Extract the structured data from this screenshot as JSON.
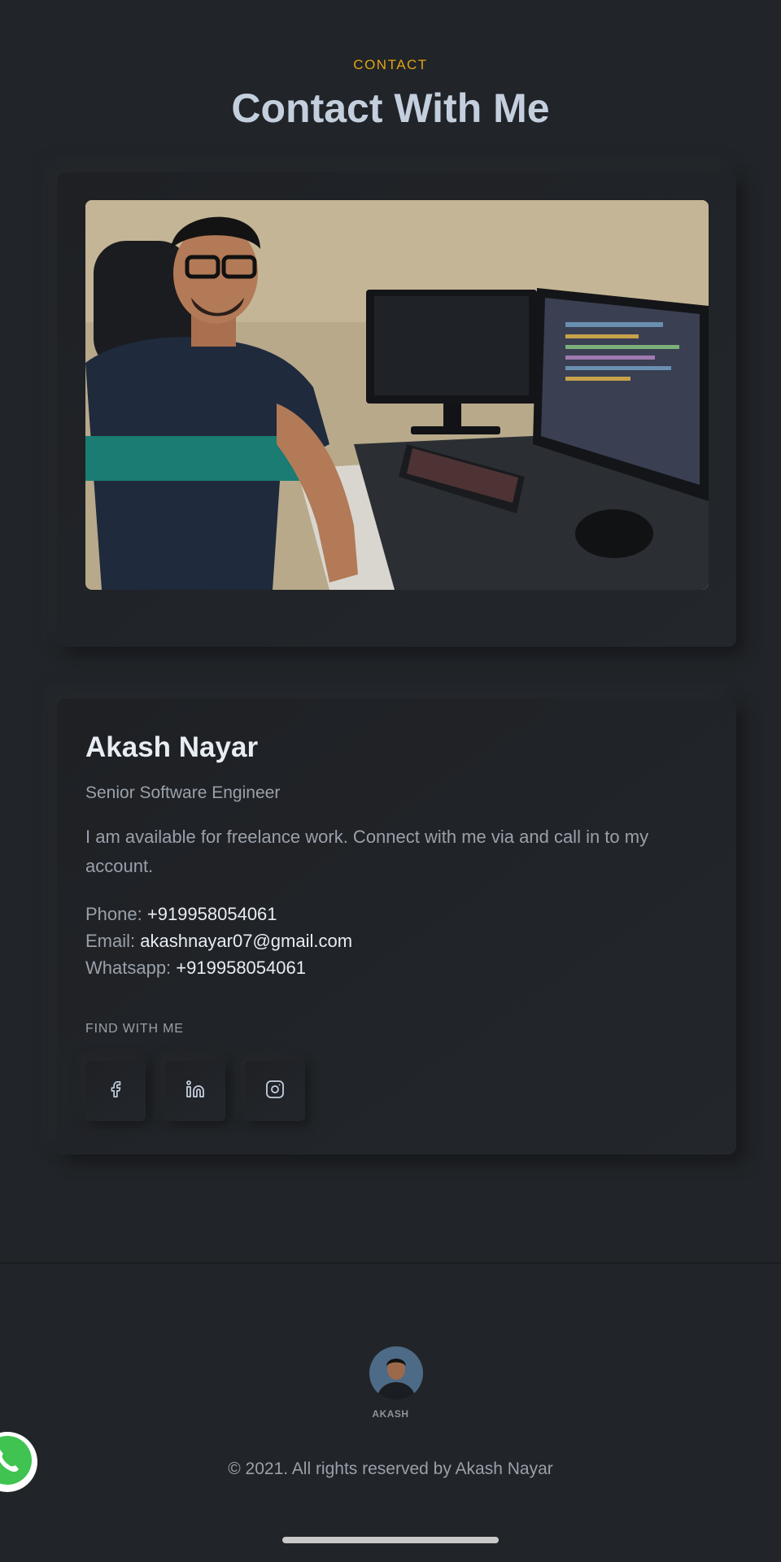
{
  "section": {
    "eyebrow": "CONTACT",
    "title": "Contact With Me"
  },
  "profile": {
    "name": "Akash Nayar",
    "role": "Senior Software Engineer",
    "description": "I am available for freelance work. Connect with me via and call in to my account.",
    "phone_label": "Phone:",
    "phone": "+919958054061",
    "email_label": "Email:",
    "email": "akashnayar07@gmail.com",
    "whatsapp_label": "Whatsapp:",
    "whatsapp": "+919958054061",
    "find_label": "FIND WITH ME",
    "socials": [
      "facebook-icon",
      "linkedin-icon",
      "instagram-icon"
    ]
  },
  "footer": {
    "avatar_name": "AKASH",
    "copyright": "© 2021. All rights reserved by Akash Nayar"
  },
  "colors": {
    "background": "#212428",
    "accent": "#e0a418",
    "heading": "#c4cfde",
    "text": "#9aa1ab",
    "whatsapp": "#40c351"
  }
}
